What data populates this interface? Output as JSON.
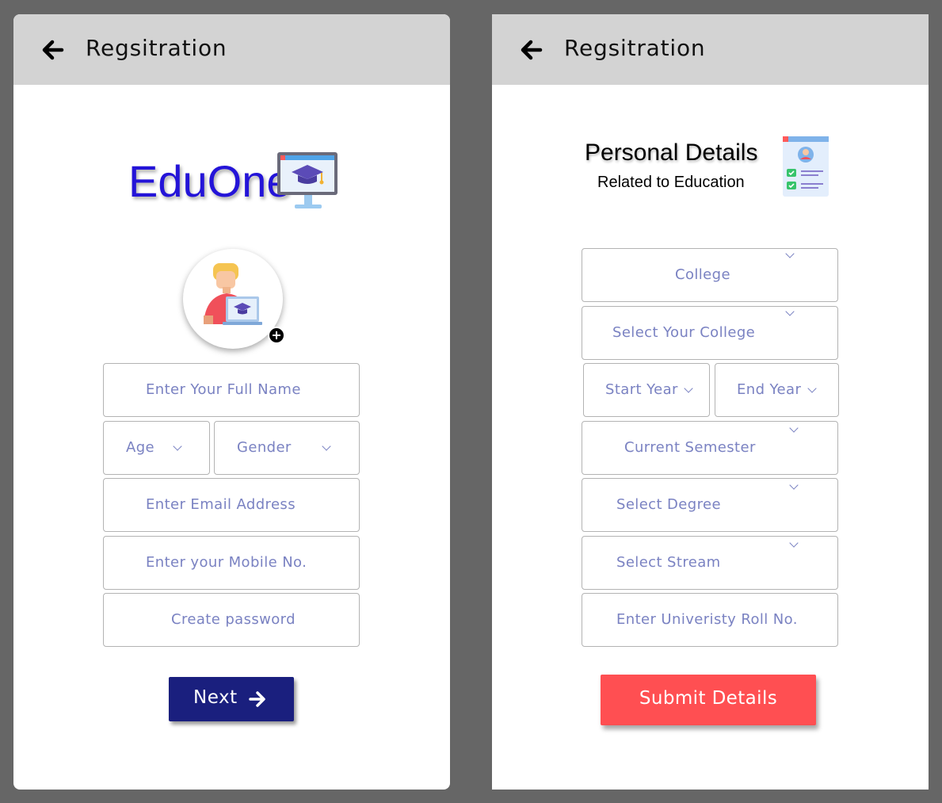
{
  "left": {
    "header": {
      "title": "Regsitration",
      "back_icon": "arrow-left-icon"
    },
    "logo": {
      "text": "EduOne",
      "icon": "monitor-graduation-cap-icon",
      "color": "#2414d8"
    },
    "avatar": {
      "icon": "student-laptop-avatar-icon",
      "add_icon": "plus-circle-icon"
    },
    "form": {
      "full_name": "Enter Your Full Name",
      "age": "Age",
      "gender": "Gender",
      "email": "Enter Email Address",
      "mobile": "Enter your Mobile No.",
      "password": "Create password"
    },
    "next_button": {
      "label": "Next",
      "icon": "arrow-right-icon",
      "color": "#1a1f7e"
    }
  },
  "right": {
    "header": {
      "title": "Regsitration",
      "back_icon": "arrow-left-icon"
    },
    "section": {
      "title": "Personal Details",
      "subtitle": "Related to Education",
      "icon": "profile-document-icon"
    },
    "form": {
      "college_type": "College",
      "college": "Select Your College",
      "start_year": "Start Year",
      "end_year": "End Year",
      "semester": "Current Semester",
      "degree": "Select Degree",
      "stream": "Select Stream",
      "roll_no": "Enter Univeristy Roll No."
    },
    "submit_button": {
      "label": "Submit Details",
      "color": "#ff4f52"
    }
  },
  "colors": {
    "background": "#666666",
    "appbar": "#d3d3d3",
    "field_text": "#7a82c2"
  }
}
